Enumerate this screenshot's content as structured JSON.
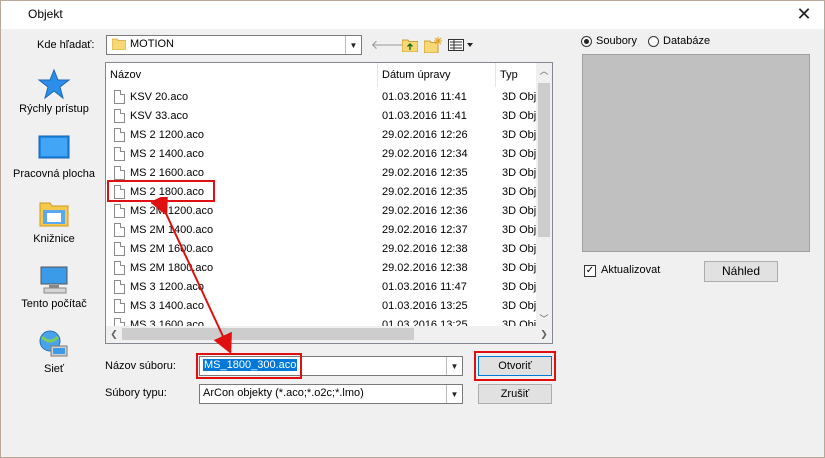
{
  "window": {
    "title": "Objekt"
  },
  "lookin": {
    "label": "Kde hľadať:",
    "value": "MOTION"
  },
  "places": [
    {
      "label": "Rýchly prístup",
      "icon": "star-icon"
    },
    {
      "label": "Pracovná plocha",
      "icon": "desktop-icon"
    },
    {
      "label": "Knižnice",
      "icon": "library-icon"
    },
    {
      "label": "Tento počítač",
      "icon": "computer-icon"
    },
    {
      "label": "Sieť",
      "icon": "network-icon"
    }
  ],
  "columns": {
    "name": "Názov",
    "date": "Dátum úpravy",
    "type": "Typ"
  },
  "files": [
    {
      "name": "KSV 20.aco",
      "date": "01.03.2016 11:41",
      "type": "3D Obj"
    },
    {
      "name": "KSV 33.aco",
      "date": "01.03.2016 11:41",
      "type": "3D Obj"
    },
    {
      "name": "MS 2 1200.aco",
      "date": "29.02.2016 12:26",
      "type": "3D Obj"
    },
    {
      "name": "MS 2 1400.aco",
      "date": "29.02.2016 12:34",
      "type": "3D Obj"
    },
    {
      "name": "MS 2 1600.aco",
      "date": "29.02.2016 12:35",
      "type": "3D Obj"
    },
    {
      "name": "MS 2 1800.aco",
      "date": "29.02.2016 12:35",
      "type": "3D Obj"
    },
    {
      "name": "MS 2M 1200.aco",
      "date": "29.02.2016 12:36",
      "type": "3D Obj"
    },
    {
      "name": "MS 2M 1400.aco",
      "date": "29.02.2016 12:37",
      "type": "3D Obj"
    },
    {
      "name": "MS 2M 1600.aco",
      "date": "29.02.2016 12:38",
      "type": "3D Obj"
    },
    {
      "name": "MS 2M 1800.aco",
      "date": "29.02.2016 12:38",
      "type": "3D Obj"
    },
    {
      "name": "MS 3 1200.aco",
      "date": "01.03.2016 11:47",
      "type": "3D Obj"
    },
    {
      "name": "MS 3 1400.aco",
      "date": "01.03.2016 13:25",
      "type": "3D Obj"
    },
    {
      "name": "MS 3 1600.aco",
      "date": "01.03.2016 13:25",
      "type": "3D Obj"
    }
  ],
  "filename": {
    "label": "Názov súboru:",
    "value": "MS_1800_300.aco"
  },
  "filetype": {
    "label": "Súbory typu:",
    "value": "ArCon objekty (*.aco;*.o2c;*.lmo)"
  },
  "buttons": {
    "open": "Otvoriť",
    "cancel": "Zrušiť",
    "preview": "Náhled"
  },
  "source": {
    "files": "Soubory",
    "database": "Databáze",
    "selected": "Soubory"
  },
  "update": {
    "label": "Aktualizovat",
    "checked": true
  },
  "colors": {
    "highlight": "#e01010",
    "selection": "#0078d7"
  }
}
